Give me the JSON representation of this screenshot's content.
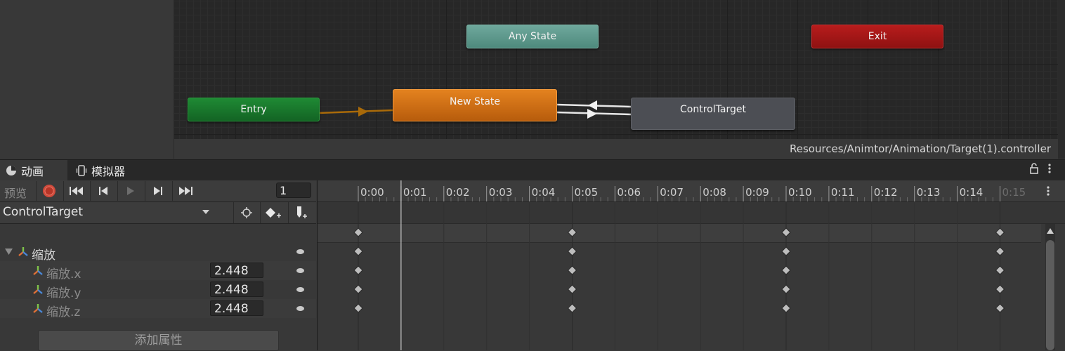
{
  "animator": {
    "states": {
      "any_state": "Any State",
      "exit": "Exit",
      "entry": "Entry",
      "new_state": "New State",
      "control_target": "ControlTarget"
    },
    "path": "Resources/Animtor/Animation/Target(1).controller"
  },
  "tabs": [
    {
      "label": "动画",
      "icon": "clock-icon"
    },
    {
      "label": "模拟器",
      "icon": "device-icon"
    }
  ],
  "toolbar": {
    "preview_label": "预览",
    "frame_value": "1",
    "buttons": [
      "record-icon",
      "first-key-icon",
      "prev-key-icon",
      "play-icon",
      "next-key-icon",
      "last-key-icon"
    ]
  },
  "clip": {
    "name": "ControlTarget"
  },
  "properties": {
    "group": "缩放",
    "items": [
      {
        "label": "缩放.x",
        "value": "2.448"
      },
      {
        "label": "缩放.y",
        "value": "2.448"
      },
      {
        "label": "缩放.z",
        "value": "2.448"
      }
    ],
    "add_button": "添加属性"
  },
  "timeline": {
    "ticks": [
      "0:00",
      "0:01",
      "0:02",
      "0:03",
      "0:04",
      "0:05",
      "0:06",
      "0:07",
      "0:08",
      "0:09",
      "0:10",
      "0:11",
      "0:12",
      "0:13",
      "0:14",
      "0:15"
    ],
    "last_tick_dim": true,
    "playhead_frame": 1,
    "keyframes": [
      0,
      5,
      10,
      15
    ],
    "colors": {
      "accent_entry": "#1f8a34",
      "accent_state": "#e4821f",
      "accent_exit": "#b81c1c",
      "accent_any": "#5f9a8d"
    }
  }
}
